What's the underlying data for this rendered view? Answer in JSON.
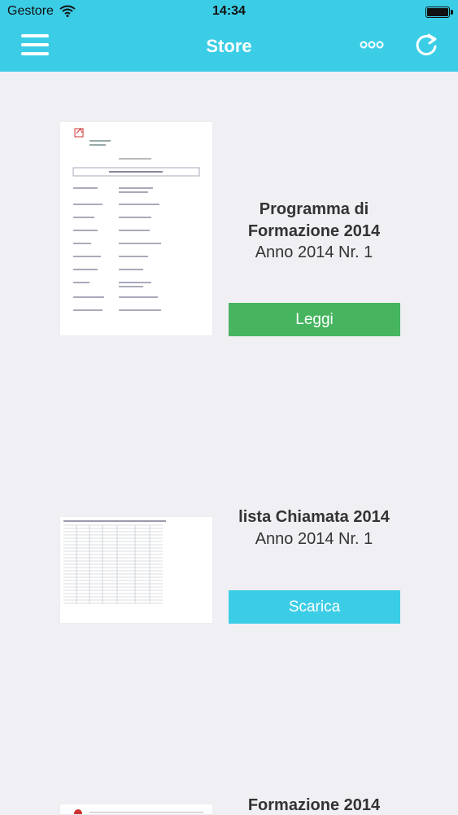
{
  "status_bar": {
    "carrier": "Gestore",
    "time": "14:34"
  },
  "navbar": {
    "title": "Store"
  },
  "items": [
    {
      "title_line1": "Programma di",
      "title_line2": "Formazione 2014",
      "subtitle": "Anno 2014 Nr. 1",
      "button": "Leggi"
    },
    {
      "title_line1": "lista Chiamata 2014",
      "subtitle": "Anno 2014 Nr. 1",
      "button": "Scarica"
    },
    {
      "title_line1": "Formazione 2014"
    }
  ],
  "colors": {
    "header": "#3ccde6",
    "read_button": "#47b560",
    "download_button": "#3ccde6",
    "background": "#efeff4"
  }
}
